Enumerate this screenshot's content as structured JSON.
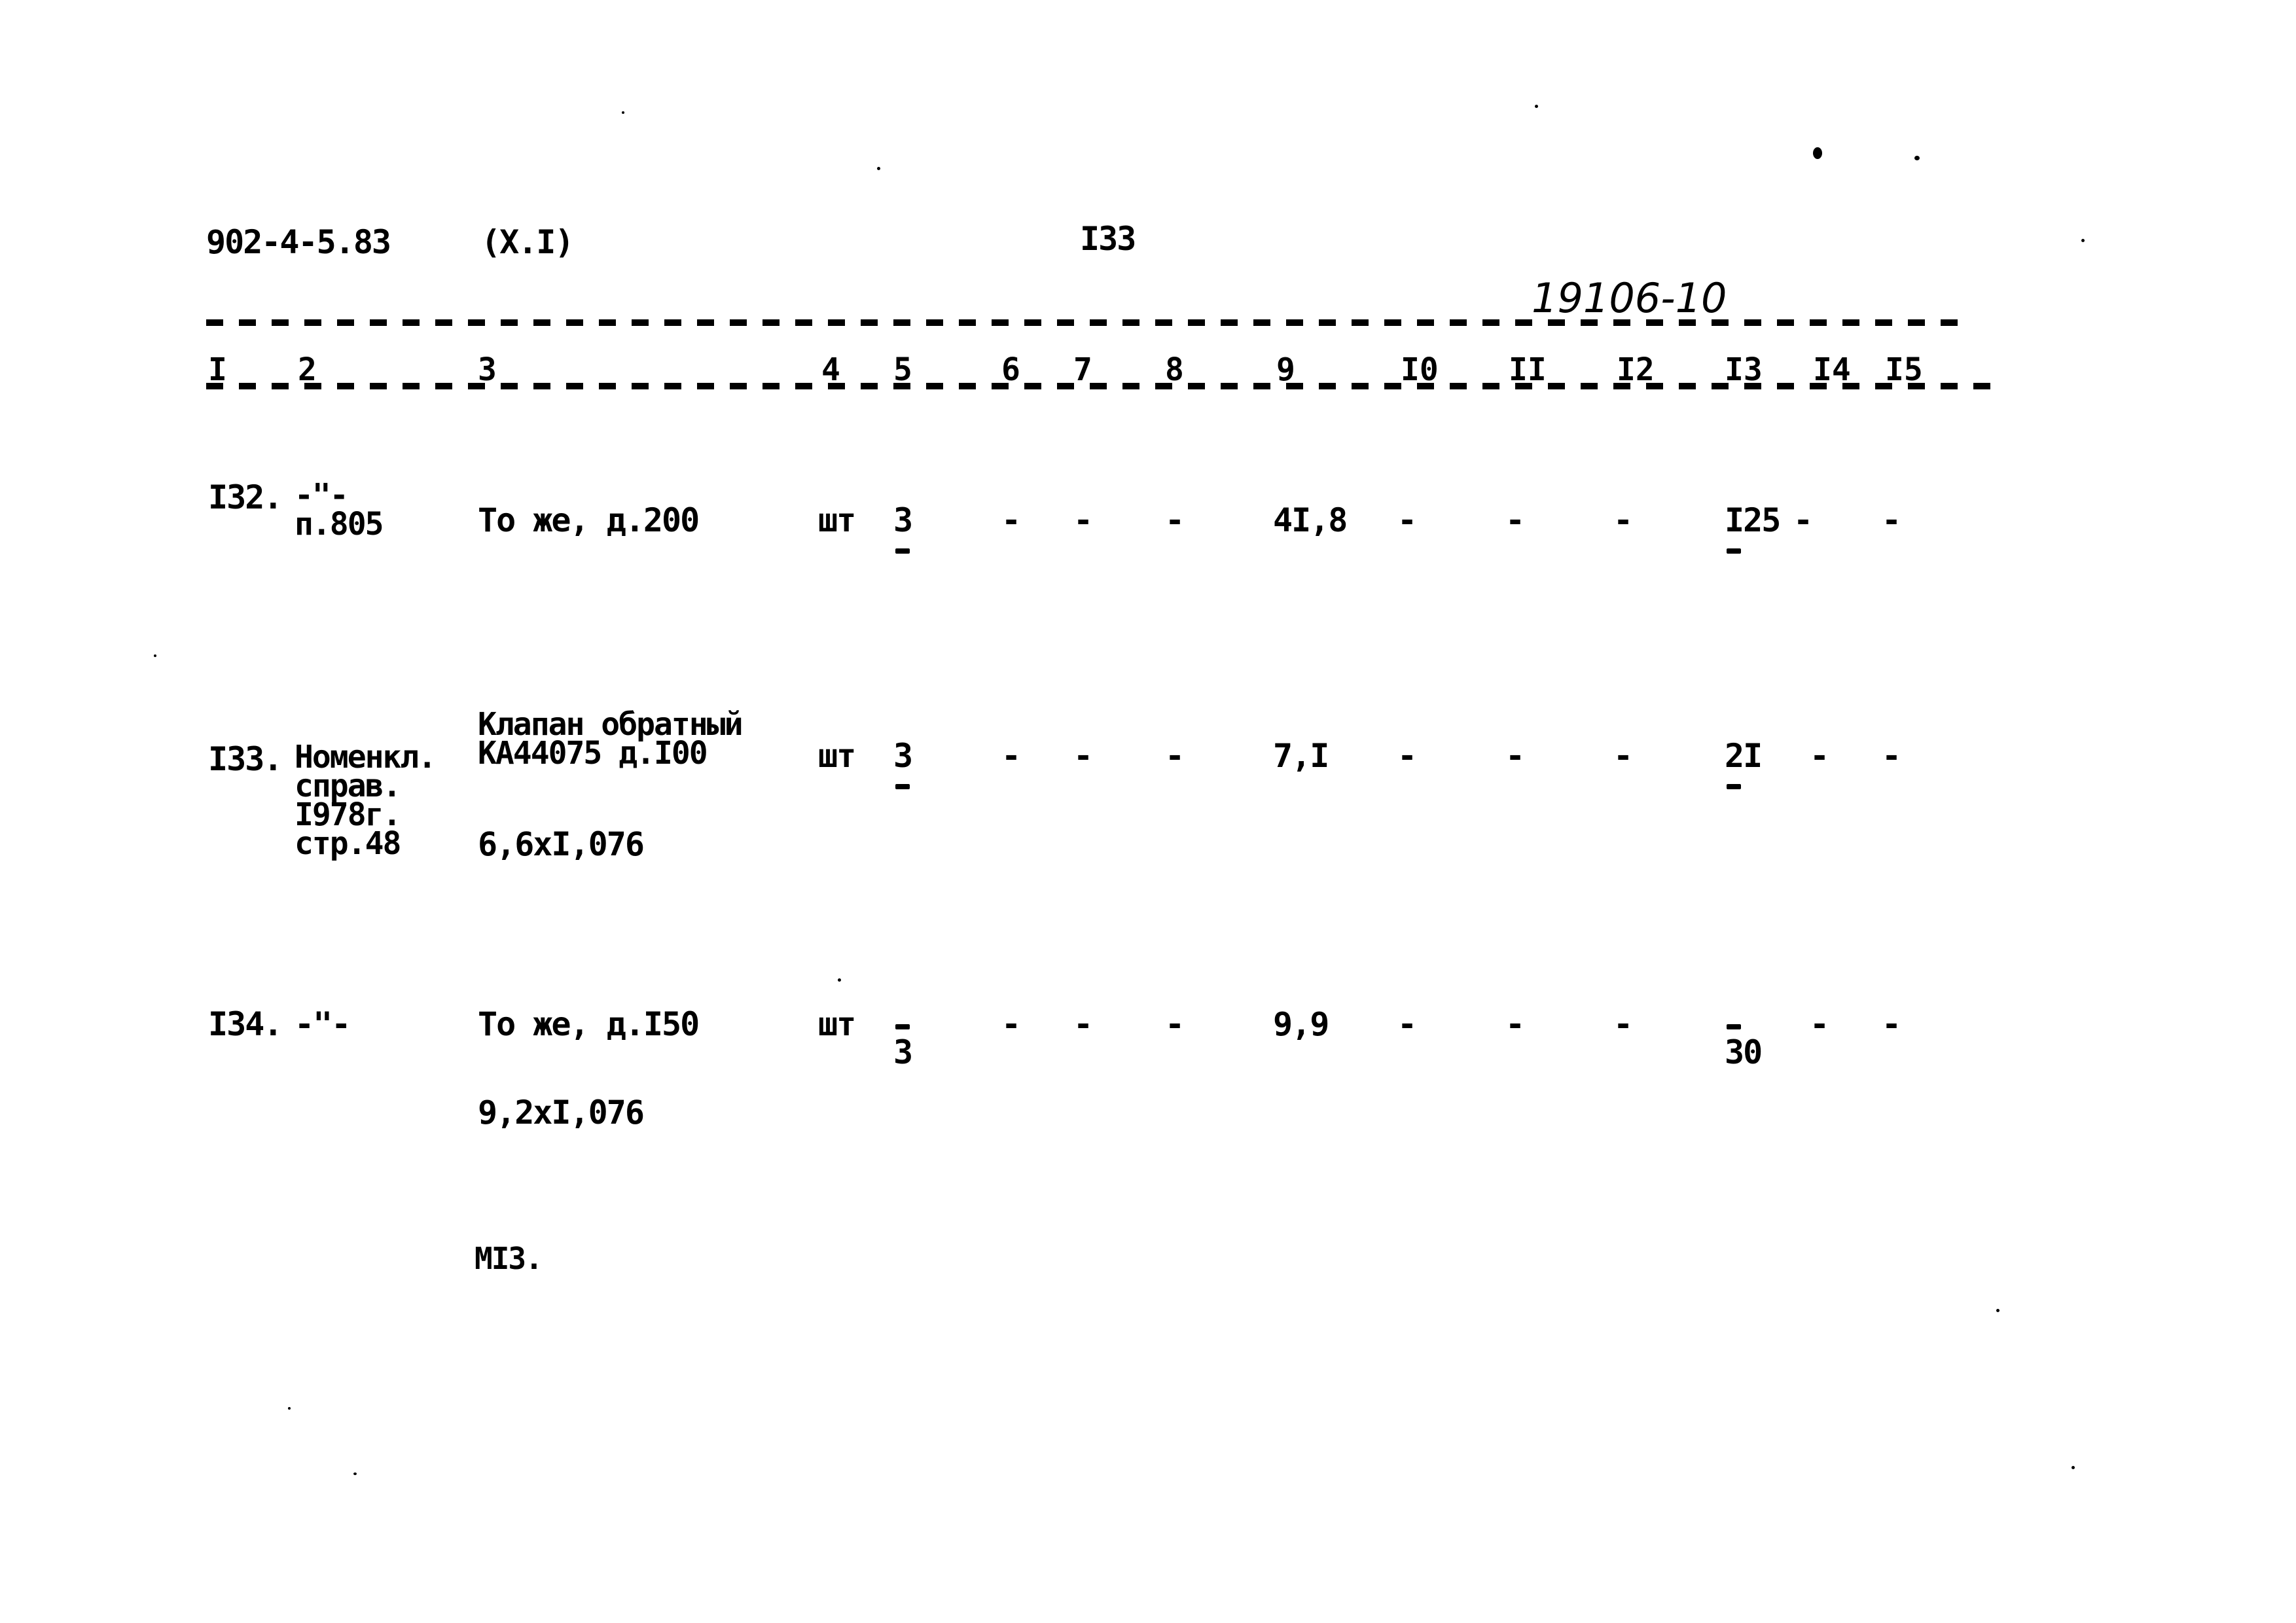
{
  "header": {
    "doc_code": "902-4-5.83",
    "section": "(X.I)",
    "page_number": "I33",
    "handwritten_ref": "19106-10"
  },
  "columns": [
    "I",
    "2",
    "3",
    "4",
    "5",
    "6",
    "7",
    "8",
    "9",
    "I0",
    "II",
    "I2",
    "I3",
    "I4",
    "I5"
  ],
  "rows": [
    {
      "num": "I32.",
      "source": [
        "-\"-",
        "п.805"
      ],
      "name": [
        "То же, д.200"
      ],
      "calc": "",
      "unit": "шт",
      "qty": "3",
      "c6": "-",
      "c7": "-",
      "c8": "-",
      "c9": "4I,8",
      "c10": "-",
      "c11": "-",
      "c12": "-",
      "c13": "I25",
      "c14": "-",
      "c15": "-"
    },
    {
      "num": "I33.",
      "source": [
        "Номенкл.",
        "справ.",
        "I978г.",
        "стр.48"
      ],
      "name": [
        "Клапан обратный",
        "КА44075 д.I00"
      ],
      "calc": "6,6xI,076",
      "unit": "шт",
      "qty": "3",
      "c6": "-",
      "c7": "-",
      "c8": "-",
      "c9": "7,I",
      "c10": "-",
      "c11": "-",
      "c12": "-",
      "c13": "2I",
      "c14": "-",
      "c15": "-"
    },
    {
      "num": "I34.",
      "source": [
        "-\"-"
      ],
      "name": [
        "То же, д.I50"
      ],
      "calc": "9,2xI,076",
      "unit": "шт",
      "qty": "3",
      "c6": "-",
      "c7": "-",
      "c8": "-",
      "c9": "9,9",
      "c10": "-",
      "c11": "-",
      "c12": "-",
      "c13": "30",
      "c14": "-",
      "c15": "-"
    }
  ],
  "footer": {
    "mark": "МI3."
  }
}
